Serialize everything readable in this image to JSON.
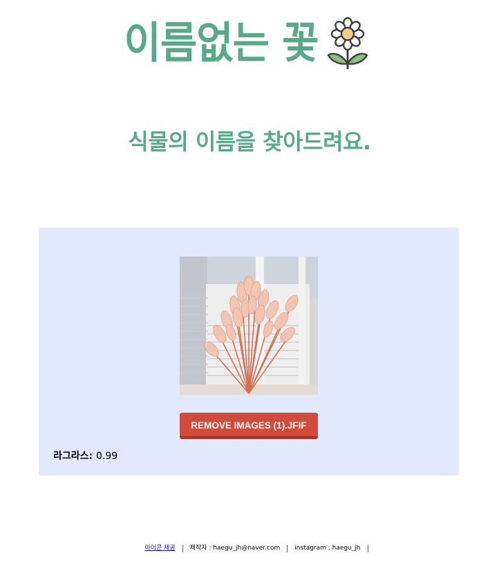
{
  "header": {
    "title": "이름없는 꽃",
    "icon": "flower-icon"
  },
  "subtitle": "식물의 이름을 찾아드려요.",
  "upload": {
    "image": "plant-photo",
    "remove_button_label": "REMOVE IMAGES (1).JFIF",
    "result_label": "라그라스:",
    "result_value": "0.99"
  },
  "footer": {
    "icon_credit": "아이콘 제공",
    "maker": "제작자 : haegu_jh@naver.com",
    "instagram": "instagram : haegu_jh"
  },
  "colors": {
    "accent": "#58a98a",
    "panel_bg": "#e3e9fd",
    "button": "#d24a3a"
  }
}
